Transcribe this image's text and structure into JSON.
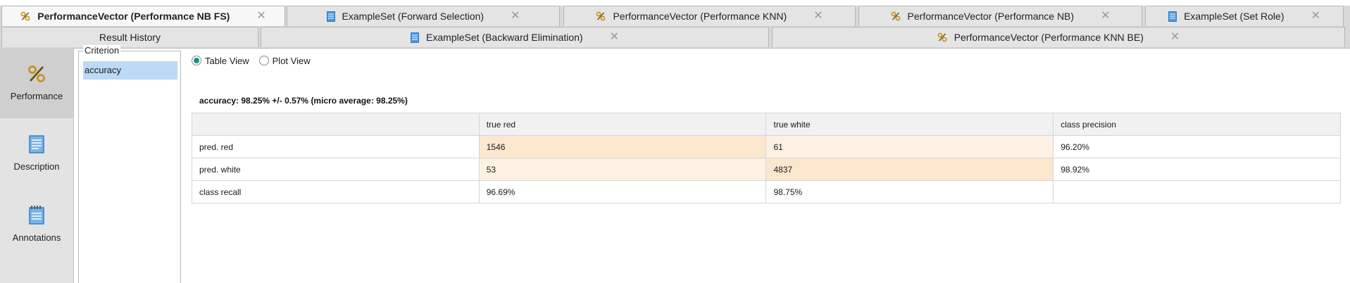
{
  "tabs_row1": [
    {
      "label": "PerformanceVector (Performance NB FS)",
      "icon": "percent-icon",
      "active": true
    },
    {
      "label": "ExampleSet (Forward Selection)",
      "icon": "table-icon",
      "active": false
    },
    {
      "label": "PerformanceVector (Performance KNN)",
      "icon": "percent-icon",
      "active": false
    },
    {
      "label": "PerformanceVector (Performance NB)",
      "icon": "percent-icon",
      "active": false
    },
    {
      "label": "ExampleSet (Set Role)",
      "icon": "table-icon",
      "active": false
    }
  ],
  "tabs_row2": [
    {
      "label": "Result History",
      "icon": "",
      "active": false
    },
    {
      "label": "ExampleSet (Backward Elimination)",
      "icon": "table-icon",
      "active": false
    },
    {
      "label": "PerformanceVector (Performance KNN BE)",
      "icon": "percent-icon",
      "active": false
    }
  ],
  "sidebar": {
    "items": [
      {
        "label": "Performance",
        "icon": "percent-icon",
        "active": true
      },
      {
        "label": "Description",
        "icon": "document-icon",
        "active": false
      },
      {
        "label": "Annotations",
        "icon": "notepad-icon",
        "active": false
      }
    ]
  },
  "criterion": {
    "legend": "Criterion",
    "items": [
      "accuracy"
    ]
  },
  "view": {
    "table_label": "Table View",
    "plot_label": "Plot View",
    "selected": "Table View"
  },
  "summary": "accuracy: 98.25% +/- 0.57% (micro average: 98.25%)",
  "matrix": {
    "headers": [
      "",
      "true red",
      "true white",
      "class precision"
    ],
    "rows": [
      {
        "label": "pred. red",
        "cells": [
          "1546",
          "61",
          "96.20%"
        ]
      },
      {
        "label": "pred. white",
        "cells": [
          "53",
          "4837",
          "98.92%"
        ]
      },
      {
        "label": "class recall",
        "cells": [
          "96.69%",
          "98.75%",
          ""
        ]
      }
    ]
  },
  "colors": {
    "selection": "#bcd9f5",
    "diagonal_cell": "#fbe7cd",
    "offdiagonal_cell": "#fcf1e3",
    "radio_selected": "#1e8e8e",
    "percent_icon": "#c8901c",
    "table_icon": "#2f7fc7"
  }
}
